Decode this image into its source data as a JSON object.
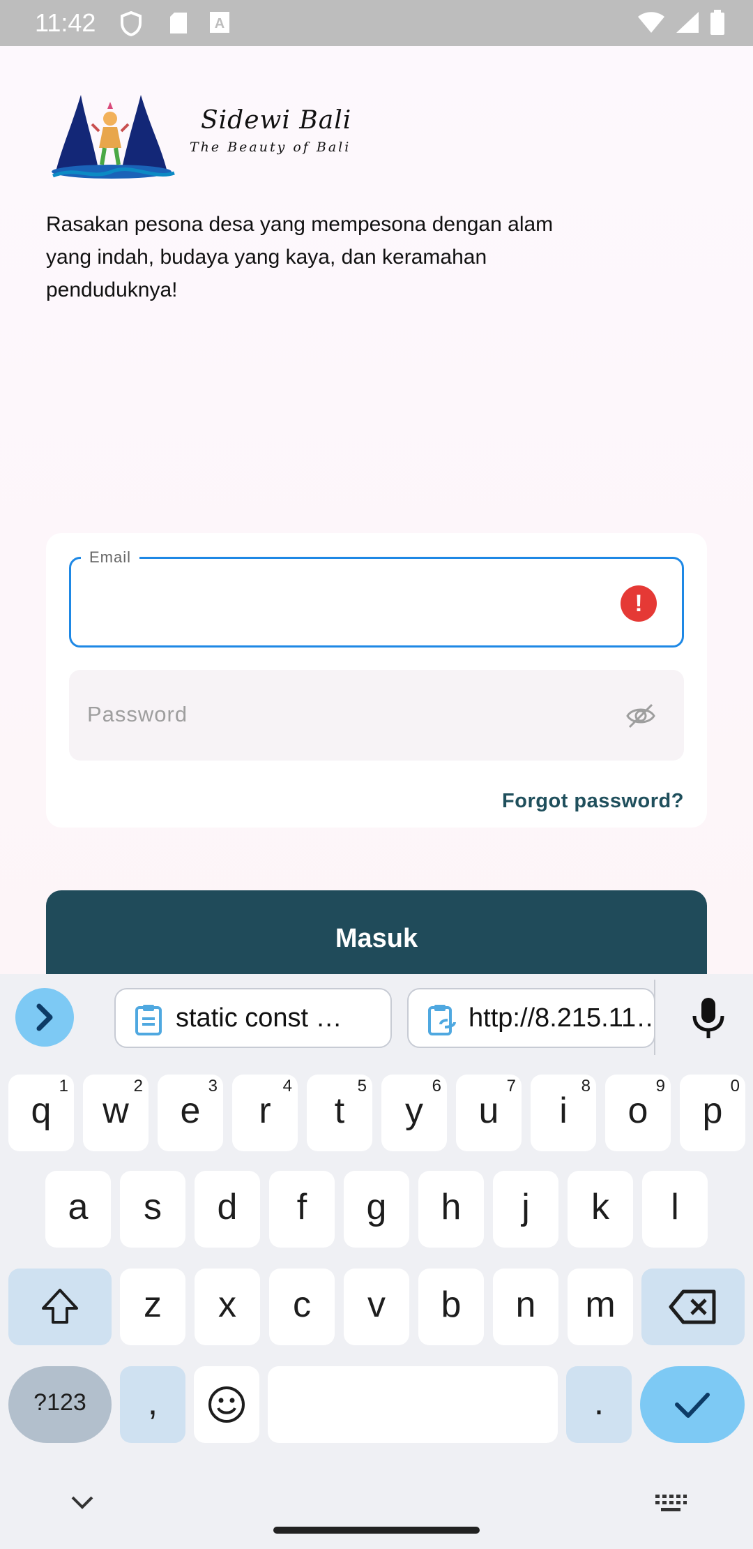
{
  "status_bar": {
    "time": "11:42"
  },
  "logo": {
    "brand": "Sidewi Bali",
    "tagline": "The Beauty of Bali"
  },
  "intro_text": "Rasakan pesona desa yang mempesona dengan alam yang indah, budaya yang kaya, dan keramahan penduduknya!",
  "form": {
    "email_label": "Email",
    "email_value": "",
    "password_placeholder": "Password",
    "forgot_label": "Forgot password?"
  },
  "submit_label": "Masuk",
  "keyboard": {
    "suggestions": [
      "static const …",
      "http://8.215.11…"
    ],
    "row1": [
      {
        "k": "q",
        "n": "1"
      },
      {
        "k": "w",
        "n": "2"
      },
      {
        "k": "e",
        "n": "3"
      },
      {
        "k": "r",
        "n": "4"
      },
      {
        "k": "t",
        "n": "5"
      },
      {
        "k": "y",
        "n": "6"
      },
      {
        "k": "u",
        "n": "7"
      },
      {
        "k": "i",
        "n": "8"
      },
      {
        "k": "o",
        "n": "9"
      },
      {
        "k": "p",
        "n": "0"
      }
    ],
    "row2": [
      "a",
      "s",
      "d",
      "f",
      "g",
      "h",
      "j",
      "k",
      "l"
    ],
    "row3": [
      "z",
      "x",
      "c",
      "v",
      "b",
      "n",
      "m"
    ],
    "symbols_label": "?123",
    "comma_label": ",",
    "period_label": "."
  },
  "colors": {
    "accent": "#204b5a",
    "focus": "#1e88e5",
    "error": "#e53935",
    "keyboard_action": "#7dc9f4"
  }
}
